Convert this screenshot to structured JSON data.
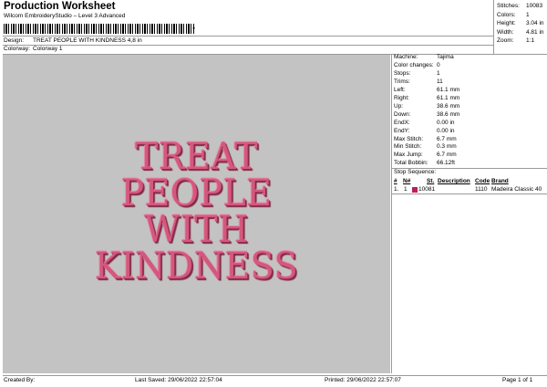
{
  "header": {
    "title": "Production Worksheet",
    "software": "Wilcom EmbroideryStudio – Level 3 Advanced",
    "barcode_suffix": "*",
    "design_label": "Design:",
    "design_value": "TREAT PEOPLE WITH KINDNESS 4,8 in",
    "colorway_label": "Colorway:",
    "colorway_value": "Colorway 1"
  },
  "top_stats": [
    {
      "label": "Stitches:",
      "value": "10083"
    },
    {
      "label": "Colors:",
      "value": "1"
    },
    {
      "label": "Height:",
      "value": "3.04 in"
    },
    {
      "label": "Width:",
      "value": "4.81 in"
    },
    {
      "label": "Zoom:",
      "value": "1:1"
    }
  ],
  "design_text": [
    "TREAT",
    "PEOPLE",
    "WITH",
    "KINDNESS"
  ],
  "design_color": "#d4587d",
  "properties": [
    {
      "label": "Machine:",
      "value": "Tajima"
    },
    {
      "label": "Color changes:",
      "value": "0"
    },
    {
      "label": "Stops:",
      "value": "1"
    },
    {
      "label": "Trims:",
      "value": "11"
    },
    {
      "label": "Left:",
      "value": "61.1 mm"
    },
    {
      "label": "Right:",
      "value": "61.1 mm"
    },
    {
      "label": "Up:",
      "value": "38.6 mm"
    },
    {
      "label": "Down:",
      "value": "38.6 mm"
    },
    {
      "label": "EndX:",
      "value": "0.00 in"
    },
    {
      "label": "EndY:",
      "value": "0.00 in"
    },
    {
      "label": "Max Stitch:",
      "value": "6.7 mm"
    },
    {
      "label": "Min Stitch:",
      "value": "0.3 mm"
    },
    {
      "label": "Max Jump:",
      "value": "6.7 mm"
    },
    {
      "label": "Total Bobbin:",
      "value": "66.12ft"
    }
  ],
  "stop_sequence": {
    "title": "Stop Sequence:",
    "headers": [
      "#",
      "N#",
      "St.",
      "Description",
      "Code",
      "Brand"
    ],
    "rows": [
      {
        "num": "1.",
        "n": "1",
        "stitches": "10081",
        "description": "",
        "code": "1110",
        "brand": "Madeira Classic 40",
        "color": "#b81f5d"
      }
    ]
  },
  "footer": {
    "created_by": "Created By:",
    "last_saved": "Last Saved: 29/06/2022 22:57:04",
    "printed": "Printed: 29/06/2022 22:57:07",
    "page": "Page 1 of 1"
  }
}
